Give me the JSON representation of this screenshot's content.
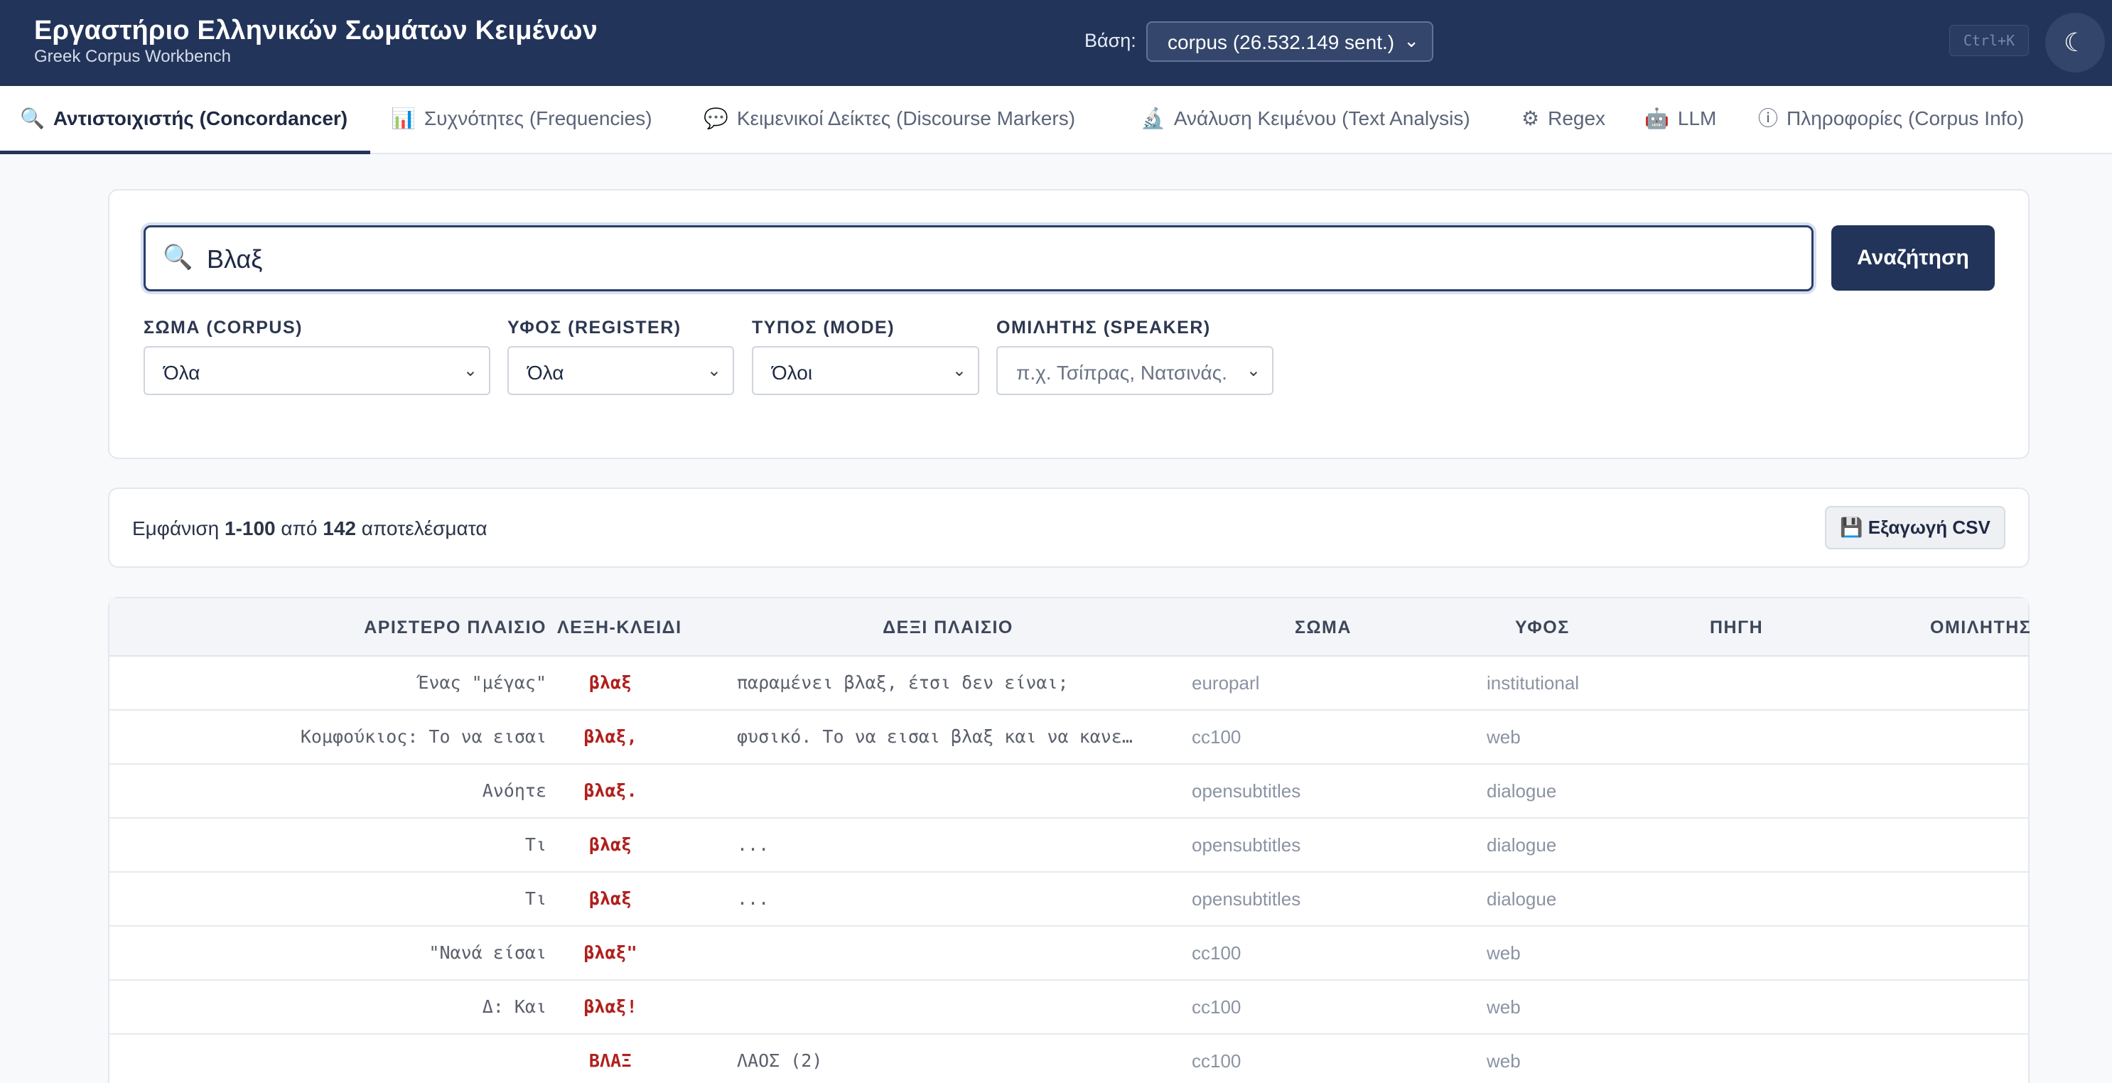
{
  "header": {
    "title": "Εργαστήριο Ελληνικών Σωμάτων Κειμένων",
    "subtitle": "Greek Corpus Workbench",
    "db_label": "Βάση:",
    "db_value": "corpus (26.532.149 sent.)",
    "shortcut": "Ctrl+K",
    "theme_icon": "moon-icon"
  },
  "tabs": [
    {
      "label": "Αντιστοιχιστής (Concordancer)",
      "icon": "🔍",
      "active": true
    },
    {
      "label": "Συχνότητες (Frequencies)",
      "icon": "📊"
    },
    {
      "label": "Κειμενικοί Δείκτες (Discourse Markers)",
      "icon": "💬"
    },
    {
      "label": "Ανάλυση Κειμένου (Text Analysis)",
      "icon": "🔬"
    },
    {
      "label": "Regex",
      "icon": "⚙"
    },
    {
      "label": "LLM",
      "icon": "🤖"
    },
    {
      "label": "Πληροφορίες (Corpus Info)",
      "icon": "ⓘ"
    }
  ],
  "search": {
    "value": "Βλαξ",
    "button": "Αναζήτηση"
  },
  "filters": {
    "corpus": {
      "label": "ΣΩΜΑ (CORPUS)",
      "value": "Όλα"
    },
    "register": {
      "label": "ΥΦΟΣ (REGISTER)",
      "value": "Όλα"
    },
    "mode": {
      "label": "ΤΥΠΟΣ (MODE)",
      "value": "Όλοι"
    },
    "speaker": {
      "label": "ΟΜΙΛΗΤΗΣ (SPEAKER)",
      "placeholder": "π.χ. Τσίπρας, Νατσινάς."
    }
  },
  "results": {
    "prefix": "Εμφάνιση",
    "range": "1-100",
    "of": "από",
    "total": "142",
    "suffix": "αποτελέσματα",
    "export": "💾 Εξαγωγή CSV"
  },
  "table": {
    "headers": {
      "left": "ΑΡΙΣΤΕΡΟ ΠΛΑΙΣΙΟ",
      "keyword": "ΛΕΞΗ-ΚΛΕΙΔΙ",
      "right": "ΔΕΞΙ ΠΛΑΙΣΙΟ",
      "corpus": "ΣΩΜΑ",
      "register": "ΥΦΟΣ",
      "source": "ΠΗΓΗ",
      "speaker": "ΟΜΙΛΗΤΗΣ"
    },
    "rows": [
      {
        "left": "Ένας \"μέγας\"",
        "kw": "βλαξ",
        "right": "παραμένει βλαξ, έτσι δεν είναι;",
        "corpus": "europarl",
        "register": "institutional"
      },
      {
        "left": "Κομφούκιος: Το να εισαι",
        "kw": "βλαξ,",
        "right": "φυσικό. Το να εισαι βλαξ και να κανε…",
        "corpus": "cc100",
        "register": "web"
      },
      {
        "left": "Ανόητε",
        "kw": "βλαξ.",
        "right": "",
        "corpus": "opensubtitles",
        "register": "dialogue"
      },
      {
        "left": "Τι",
        "kw": "βλαξ",
        "right": "...",
        "corpus": "opensubtitles",
        "register": "dialogue"
      },
      {
        "left": "Τι",
        "kw": "βλαξ",
        "right": "...",
        "corpus": "opensubtitles",
        "register": "dialogue"
      },
      {
        "left": "\"Νανά είσαι",
        "kw": "βλαξ\"",
        "right": "",
        "corpus": "cc100",
        "register": "web"
      },
      {
        "left": "Δ: Και",
        "kw": "βλαξ!",
        "right": "",
        "corpus": "cc100",
        "register": "web"
      },
      {
        "left": "",
        "kw": "ΒΛΑΞ",
        "right": "ΛΑΟΣ (2)",
        "corpus": "cc100",
        "register": "web"
      }
    ]
  }
}
